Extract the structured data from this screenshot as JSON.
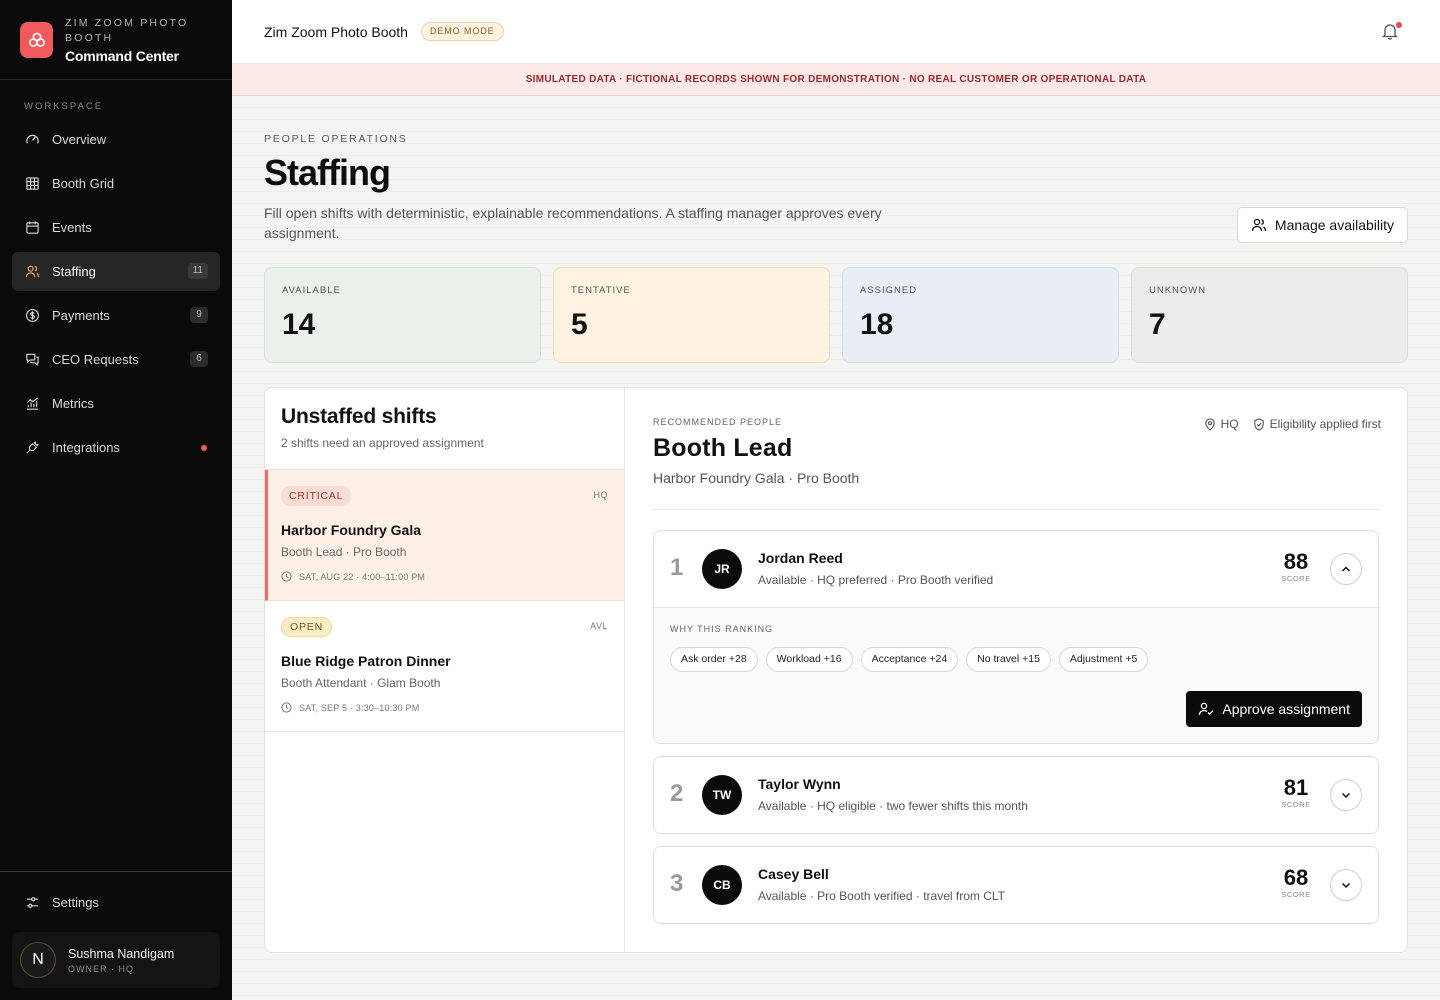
{
  "brand": {
    "sub": "ZIM ZOOM PHOTO BOOTH",
    "title": "Command Center"
  },
  "sidebar": {
    "section_label": "WORKSPACE",
    "items": [
      {
        "label": "Overview",
        "icon": "gauge-icon",
        "badge": ""
      },
      {
        "label": "Booth Grid",
        "icon": "grid-icon",
        "badge": ""
      },
      {
        "label": "Events",
        "icon": "calendar-icon",
        "badge": ""
      },
      {
        "label": "Staffing",
        "icon": "users-icon",
        "badge": "11",
        "active": true
      },
      {
        "label": "Payments",
        "icon": "dollar-icon",
        "badge": "9"
      },
      {
        "label": "CEO Requests",
        "icon": "chat-icon",
        "badge": "6"
      },
      {
        "label": "Metrics",
        "icon": "chart-icon",
        "badge": ""
      },
      {
        "label": "Integrations",
        "icon": "plug-icon",
        "badge": "",
        "dot": true
      }
    ],
    "settings_label": "Settings",
    "user": {
      "initial": "N",
      "name": "Sushma Nandigam",
      "role": "OWNER · HQ"
    }
  },
  "topbar": {
    "title": "Zim Zoom Photo Booth",
    "pill": "DEMO MODE"
  },
  "banner": "SIMULATED DATA · FICTIONAL RECORDS SHOWN FOR DEMONSTRATION · NO REAL CUSTOMER OR OPERATIONAL DATA",
  "page": {
    "eyebrow": "PEOPLE OPERATIONS",
    "title": "Staffing",
    "description": "Fill open shifts with deterministic, explainable recommendations. A staffing manager approves every assignment.",
    "manage_button": "Manage availability"
  },
  "stats": [
    {
      "label": "AVAILABLE",
      "value": "14"
    },
    {
      "label": "TENTATIVE",
      "value": "5"
    },
    {
      "label": "ASSIGNED",
      "value": "18"
    },
    {
      "label": "UNKNOWN",
      "value": "7"
    }
  ],
  "shifts_panel": {
    "title": "Unstaffed shifts",
    "subtitle": "2 shifts need an approved assignment",
    "shifts": [
      {
        "tag": "CRITICAL",
        "code": "HQ",
        "name": "Harbor Foundry Gala",
        "role": "Booth Lead · Pro Booth",
        "time": "SAT, AUG 22 · 4:00–11:00 PM"
      },
      {
        "tag": "OPEN",
        "code": "AVL",
        "name": "Blue Ridge Patron Dinner",
        "role": "Booth Attendant · Glam Booth",
        "time": "SAT, SEP 5 · 3:30–10:30 PM"
      }
    ]
  },
  "recommend": {
    "eyebrow": "RECOMMENDED PEOPLE",
    "location": "HQ",
    "eligibility": "Eligibility applied first",
    "title": "Booth Lead",
    "subtitle": "Harbor Foundry Gala · Pro Booth",
    "score_label": "SCORE",
    "why_label": "WHY THIS RANKING",
    "approve_label": "Approve assignment",
    "candidates": [
      {
        "rank": "1",
        "initials": "JR",
        "name": "Jordan Reed",
        "detail": "Available · HQ preferred · Pro Booth verified",
        "score": "88"
      },
      {
        "rank": "2",
        "initials": "TW",
        "name": "Taylor Wynn",
        "detail": "Available · HQ eligible · two fewer shifts this month",
        "score": "81"
      },
      {
        "rank": "3",
        "initials": "CB",
        "name": "Casey Bell",
        "detail": "Available · Pro Booth verified · travel from CLT",
        "score": "68"
      }
    ],
    "chips": [
      "Ask order +28",
      "Workload +16",
      "Acceptance +24",
      "No travel +15",
      "Adjustment +5"
    ]
  }
}
